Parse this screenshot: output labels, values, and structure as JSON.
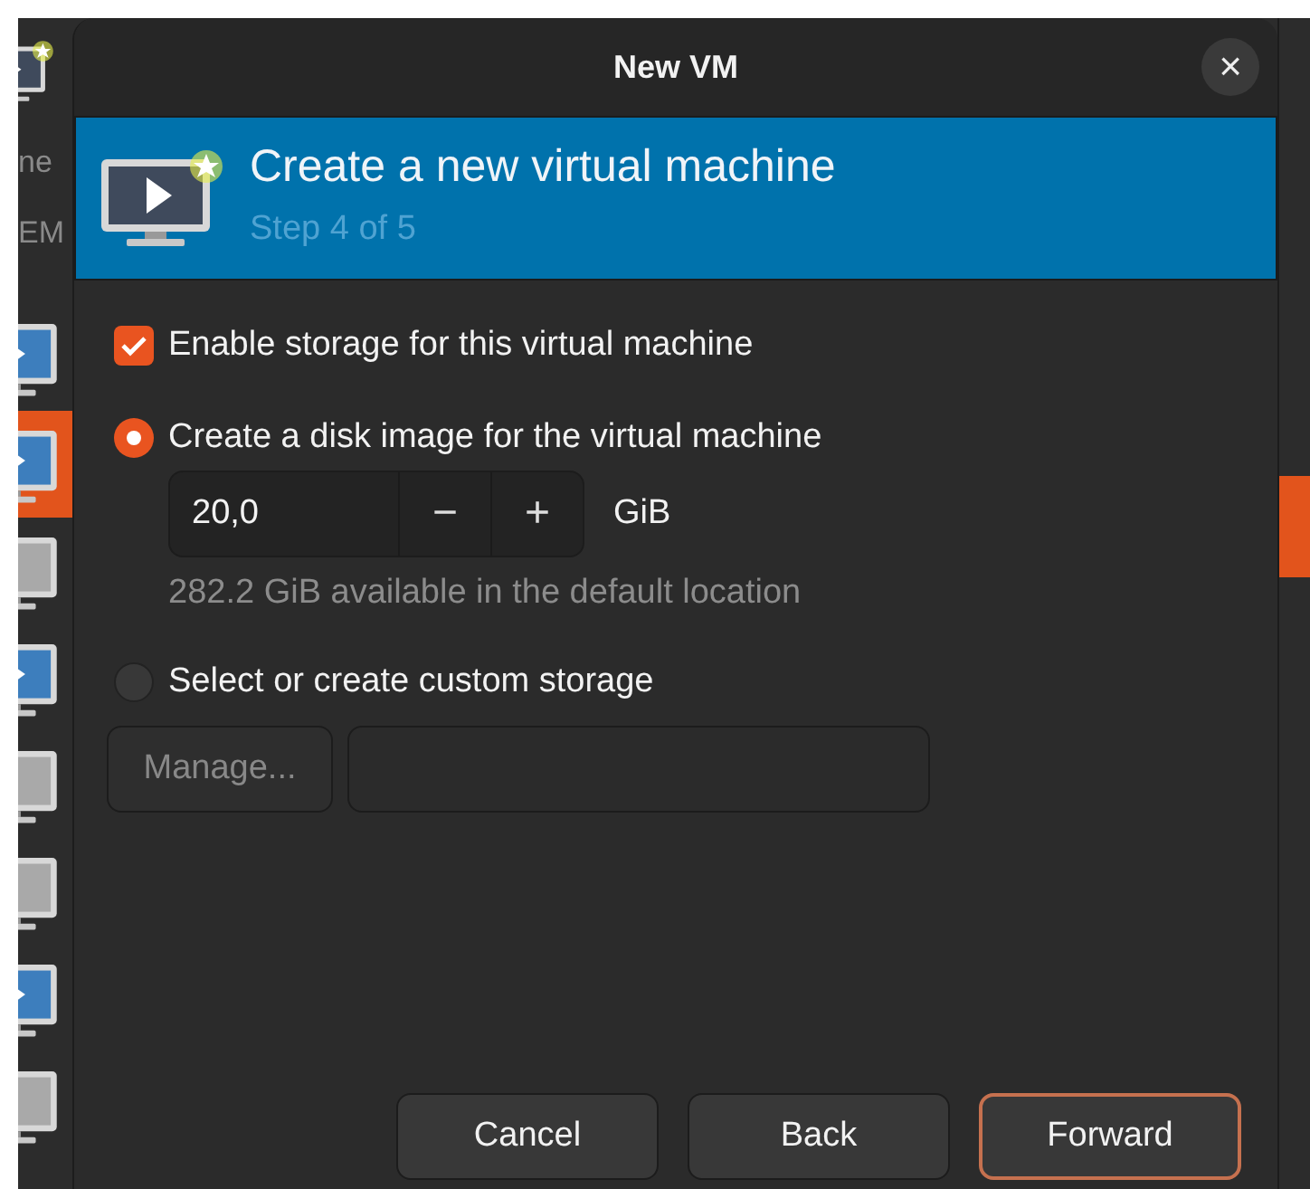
{
  "background_window": {
    "texts": [
      "ne",
      "EM"
    ],
    "vms": [
      {
        "running": true,
        "selected": false
      },
      {
        "running": true,
        "selected": true
      },
      {
        "running": false,
        "selected": false
      },
      {
        "running": true,
        "selected": false
      },
      {
        "running": false,
        "selected": false
      },
      {
        "running": false,
        "selected": false
      },
      {
        "running": true,
        "selected": false
      },
      {
        "running": false,
        "selected": false
      }
    ]
  },
  "window": {
    "title": "New VM",
    "close": "×"
  },
  "header": {
    "title": "Create a new virtual machine",
    "subtitle": "Step 4 of 5"
  },
  "enable_storage": {
    "label": "Enable storage for this virtual machine",
    "checked": true
  },
  "storage_options": [
    {
      "label": "Create a disk image for the virtual machine",
      "selected": true
    },
    {
      "label": "Select or create custom storage",
      "selected": false
    }
  ],
  "disk_size": {
    "value": "20,0",
    "decrement": "−",
    "increment": "+",
    "unit": "GiB",
    "hint": "282.2 GiB available in the default location"
  },
  "custom_storage": {
    "manage_button": "Manage...",
    "disabled": true
  },
  "buttons": [
    {
      "label": "Cancel",
      "default": false
    },
    {
      "label": "Back",
      "default": false
    },
    {
      "label": "Forward",
      "default": true
    }
  ]
}
